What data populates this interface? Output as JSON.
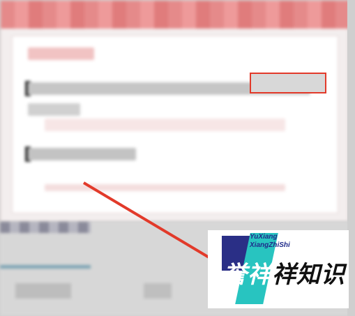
{
  "dialog": {
    "title": "",
    "heading": "",
    "lines": [
      "",
      ""
    ]
  },
  "lower_panel": {
    "confirm_label": ""
  },
  "watermark": {
    "latin_line_1": "YuXiang",
    "latin_line_2": "XiangZhiShi",
    "chinese_prefix": "誉",
    "chinese_highlight": "祥",
    "chinese_suffix": "祥知识"
  },
  "colors": {
    "annotation_red": "#e23a2a",
    "watermark_navy": "#2a2f86",
    "watermark_teal": "#28c4c0"
  }
}
